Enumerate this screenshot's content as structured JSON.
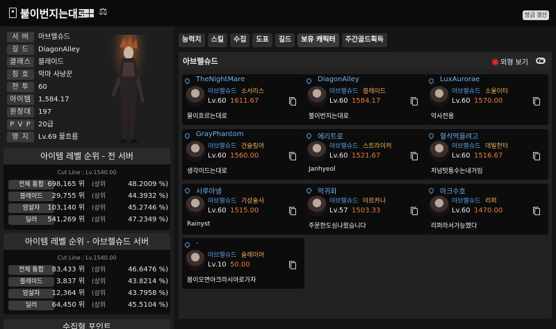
{
  "header": {
    "title": "불이번지는대로",
    "refresh_label": "방금 갱신",
    "icons": [
      "bookmark-icon",
      "grid-icon",
      "scale-icon"
    ]
  },
  "profile": {
    "rows": [
      {
        "label": "서 버",
        "value": "아브렐슈드"
      },
      {
        "label": "길 드",
        "value": "DiagonAlley"
      },
      {
        "label": "클래스",
        "value": "블레이드"
      },
      {
        "label": "칭 호",
        "value": "악마 사냥꾼"
      },
      {
        "label": "전 투",
        "value": "60"
      },
      {
        "label": "아이템",
        "value": "1,584.17"
      },
      {
        "label": "원정대",
        "value": "197"
      },
      {
        "label": "P V P",
        "value": "20급"
      },
      {
        "label": "영 지",
        "value": "Lv.69 물흐름"
      }
    ]
  },
  "rank_all": {
    "title": "아이템 레벨 순위 - 전 서버",
    "cut": "Cut Line : Lv.1540.00",
    "rows": [
      {
        "label": "전체 통합",
        "pos": "698,165 위",
        "pre": "(상위",
        "pct": "48.2009 %)"
      },
      {
        "label": "블레이드",
        "pos": "29,755 위",
        "pre": "(상위",
        "pct": "44.3932 %)"
      },
      {
        "label": "암살자",
        "pos": "103,140 위",
        "pre": "(상위",
        "pct": "45.2746 %)"
      },
      {
        "label": "딜러",
        "pos": "541,269 위",
        "pre": "(상위",
        "pct": "47.2349 %)"
      }
    ]
  },
  "rank_server": {
    "title": "아이템 레벨 순위 - 아브렐슈드 서버",
    "cut": "Cut Line : Lv.1540.00",
    "rows": [
      {
        "label": "전체 통합",
        "pos": "83,433 위",
        "pre": "(상위",
        "pct": "46.6476 %)"
      },
      {
        "label": "블레이드",
        "pos": "3,837 위",
        "pre": "(상위",
        "pct": "43.8214 %)"
      },
      {
        "label": "암살자",
        "pos": "12,364 위",
        "pre": "(상위",
        "pct": "43.7958 %)"
      },
      {
        "label": "딜러",
        "pos": "64,450 위",
        "pre": "(상위",
        "pct": "45.5104 %)"
      }
    ]
  },
  "collect_title": "수집형 포인트",
  "tabs": [
    {
      "label": "능력치",
      "active": false
    },
    {
      "label": "스킬",
      "active": false
    },
    {
      "label": "수집",
      "active": false
    },
    {
      "label": "도표",
      "active": false
    },
    {
      "label": "길드",
      "active": false
    },
    {
      "label": "보유 캐릭터",
      "active": true
    },
    {
      "label": "주간골드획득",
      "active": false
    }
  ],
  "server_bar": {
    "name": "아브렐슈드",
    "view_label": "외형 보기"
  },
  "characters": [
    {
      "name": "TheNightMare",
      "server": "아브렐슈드",
      "class": "소서리스",
      "lv": "Lv.60",
      "ilvl": "1611.67",
      "guild": "물이흐르는대로"
    },
    {
      "name": "DiagonAlley",
      "server": "아브렐슈드",
      "class": "블레이드",
      "lv": "Lv.60",
      "ilvl": "1584.17",
      "guild": "불이번지는대로"
    },
    {
      "name": "LuxAurorae",
      "server": "아브렐슈드",
      "class": "소울이터",
      "lv": "Lv.60",
      "ilvl": "1570.00",
      "guild": "악사전용"
    },
    {
      "name": "GrayPhantom",
      "server": "아브렐슈드",
      "class": "건슬링어",
      "lv": "Lv.60",
      "ilvl": "1560.00",
      "guild": "생각이드는대로"
    },
    {
      "name": "에리트로",
      "server": "아브렐슈드",
      "class": "스트라이커",
      "lv": "Lv.60",
      "ilvl": "1521.67",
      "guild": "Janhyeol"
    },
    {
      "name": "혈석먹을려고",
      "server": "아브렐슈드",
      "class": "데빌헌터",
      "lv": "Lv.60",
      "ilvl": "1516.67",
      "guild": "저넘텃통수는내거임"
    },
    {
      "name": "시루아넬",
      "server": "아브렐슈드",
      "class": "기상술사",
      "lv": "Lv.60",
      "ilvl": "1515.00",
      "guild": "Rainyst"
    },
    {
      "name": "악귀화",
      "server": "아브렐슈드",
      "class": "아르카나",
      "lv": "Lv.57",
      "ilvl": "1503.33",
      "guild": "주문한도심나왔습니다"
    },
    {
      "name": "아크수호",
      "server": "아브렐슈드",
      "class": "리퍼",
      "lv": "Lv.60",
      "ilvl": "1470.00",
      "guild": "리퍼라서가능했다"
    },
    {
      "name": "-",
      "server": "아브렐슈드",
      "class": "슬레이어",
      "lv": "Lv.10",
      "ilvl": "50.00",
      "guild": "봄이오면아크라시아로가자"
    }
  ]
}
